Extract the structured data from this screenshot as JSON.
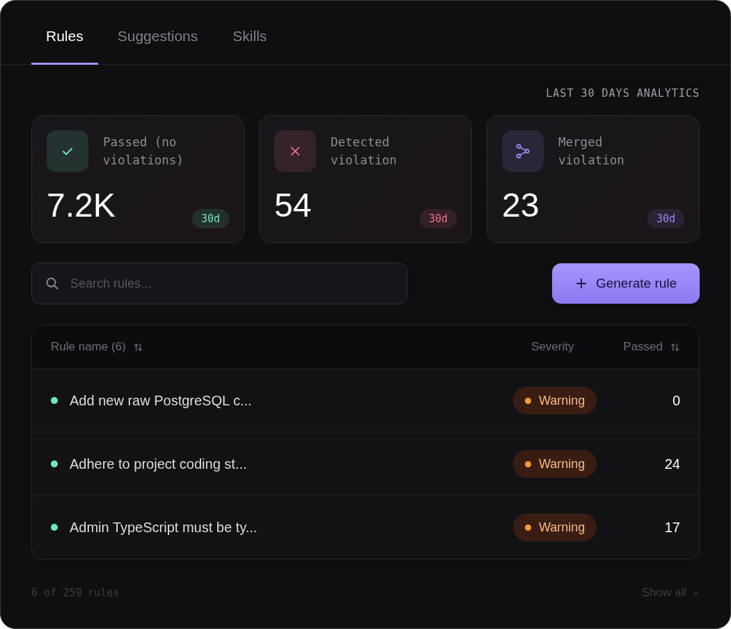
{
  "tabs": [
    {
      "label": "Rules",
      "selected": true
    },
    {
      "label": "Suggestions",
      "selected": false
    },
    {
      "label": "Skills",
      "selected": false
    }
  ],
  "analytics_label": "LAST 30 DAYS ANALYTICS",
  "stats": [
    {
      "kind": "passed",
      "label": "Passed (no violations)",
      "value": "7.2K",
      "period": "30d",
      "color": "#6ee7c5"
    },
    {
      "kind": "detected",
      "label": "Detected violation",
      "value": "54",
      "period": "30d",
      "color": "#f0708c"
    },
    {
      "kind": "merged",
      "label": "Merged violation",
      "value": "23",
      "period": "30d",
      "color": "#9b87f5"
    }
  ],
  "search": {
    "placeholder": "Search rules..."
  },
  "generate_button": {
    "label": "Generate rule"
  },
  "table": {
    "columns": [
      {
        "label": "Rule name (6)",
        "sortable": true
      },
      {
        "label": "Severity",
        "sortable": false
      },
      {
        "label": "Passed",
        "sortable": true
      }
    ],
    "rows": [
      {
        "name": "Add new raw PostgreSQL c...",
        "severity": "Warning",
        "passed": "0"
      },
      {
        "name": "Adhere to project coding st...",
        "severity": "Warning",
        "passed": "24"
      },
      {
        "name": "Admin TypeScript must be ty...",
        "severity": "Warning",
        "passed": "17"
      }
    ]
  },
  "footer": {
    "count": "6 of 259 rules",
    "show_all": "Show all"
  }
}
